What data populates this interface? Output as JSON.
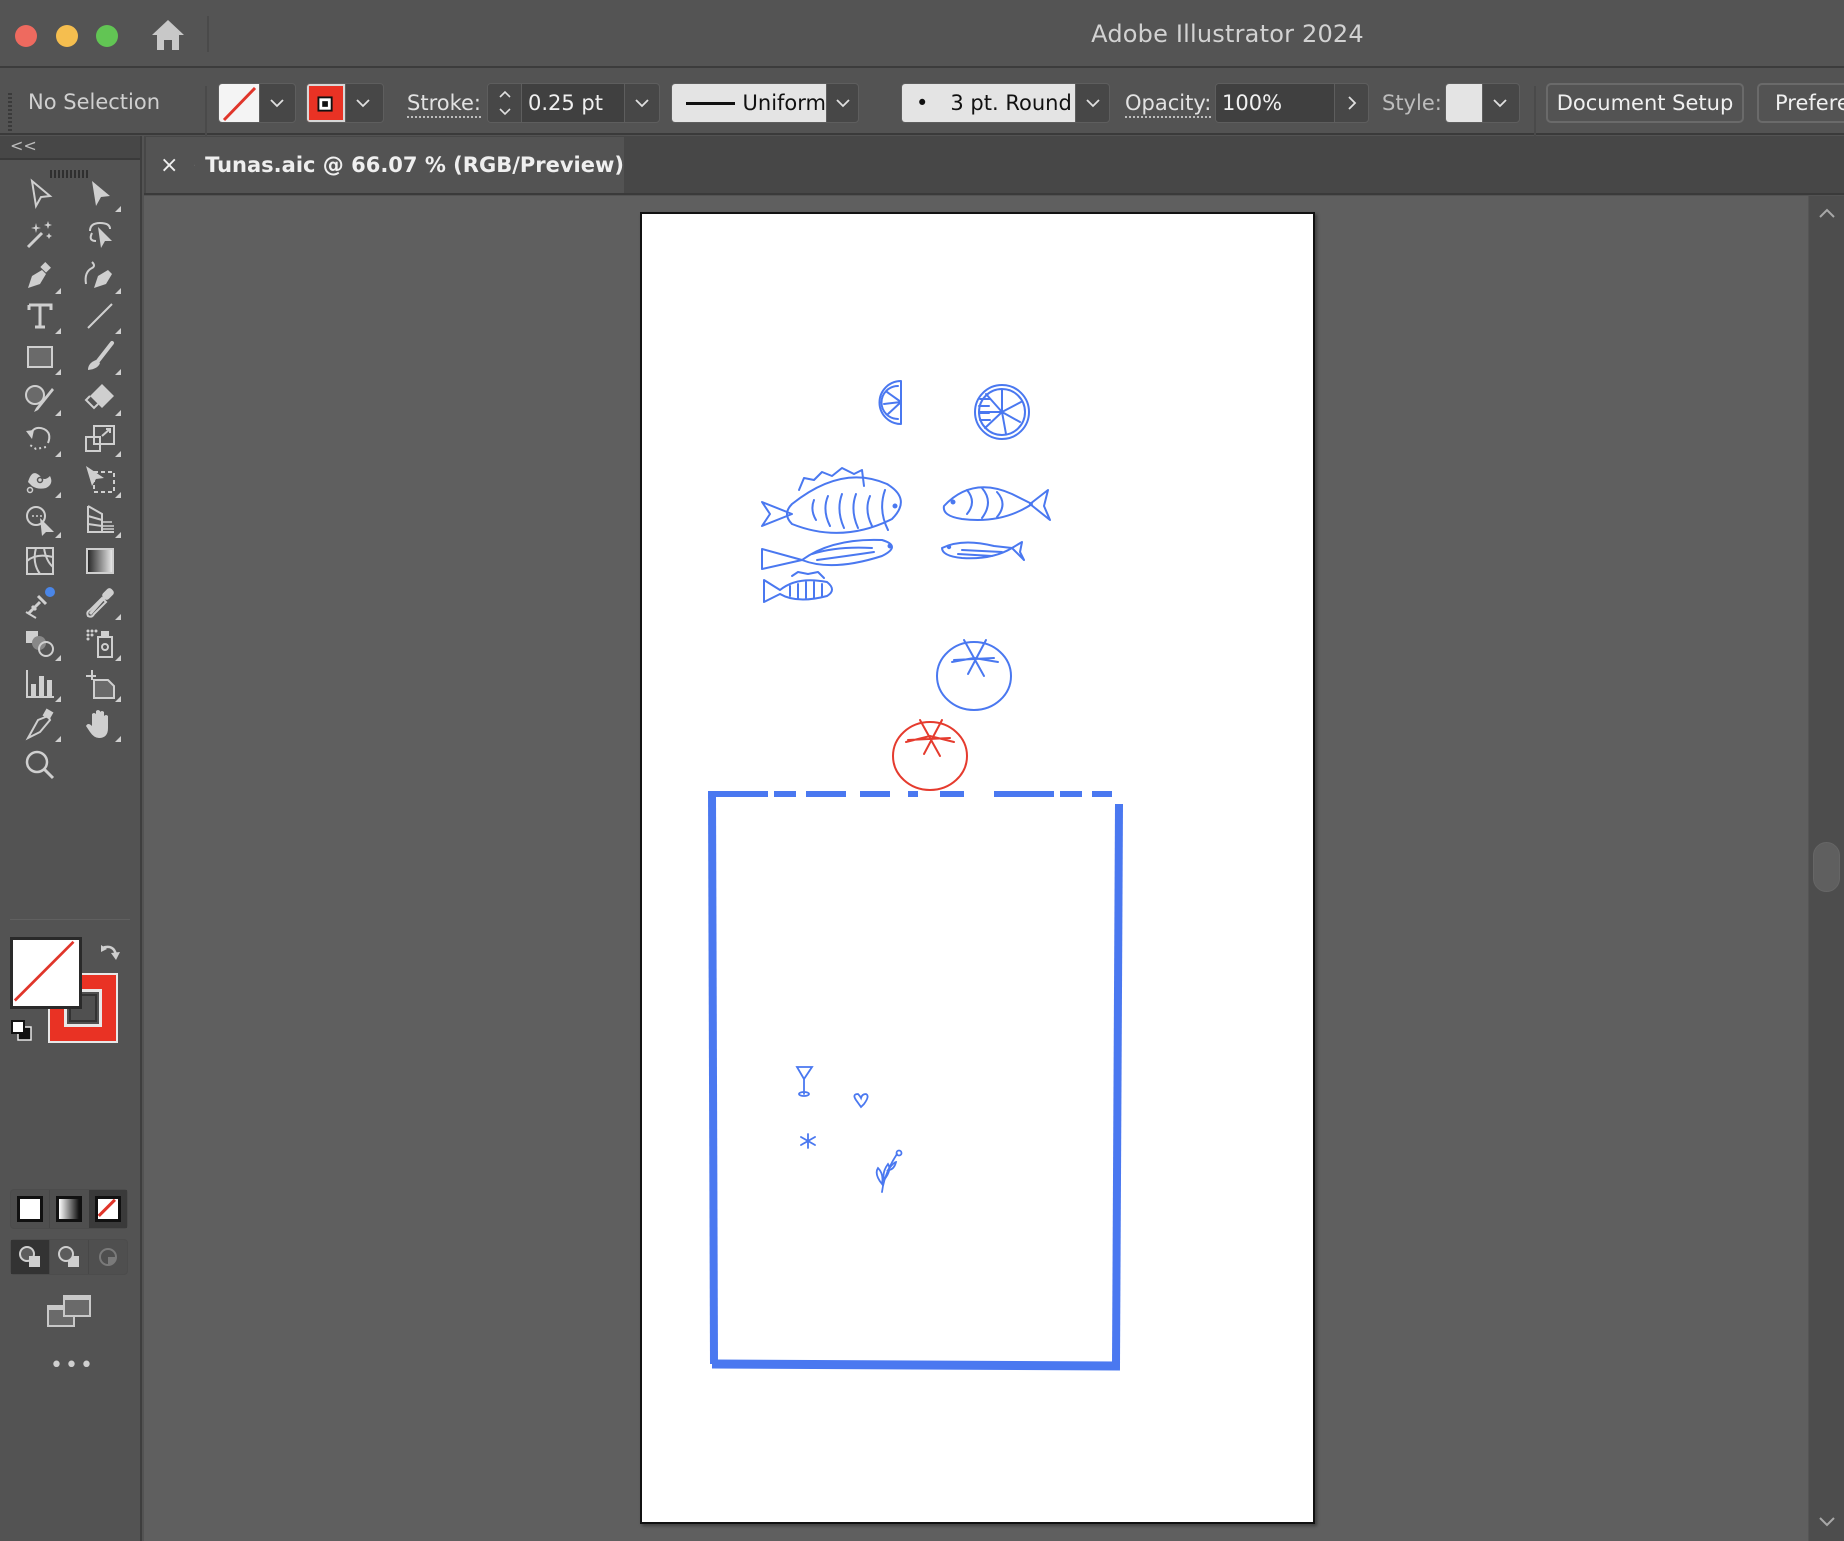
{
  "window": {
    "title": "Adobe Illustrator 2024",
    "traffic_lights": [
      "close",
      "minimize",
      "maximize"
    ]
  },
  "control_bar": {
    "selection_status": "No Selection",
    "fill": {
      "state": "none",
      "icon": "none-swatch-icon"
    },
    "stroke_swatch": {
      "color": "#e93224"
    },
    "stroke_label": "Stroke:",
    "stroke_weight": "0.25 pt",
    "variable_width_profile": "Uniform",
    "brush_definition": "3 pt. Round",
    "brush_dot": "•",
    "opacity_label": "Opacity:",
    "opacity_value": "100%",
    "style_label": "Style:",
    "document_setup_label": "Document Setup",
    "preferences_label": "Preferences"
  },
  "document_tab": {
    "close_glyph": "×",
    "title": "Tunas.aic @ 66.07 % (RGB/Preview)",
    "cloud_document": true
  },
  "sidebar": {
    "collapse_glyph": "<<",
    "tools": [
      [
        "selection-tool",
        "direct-selection-tool"
      ],
      [
        "magic-wand-tool",
        "lasso-tool"
      ],
      [
        "pen-tool",
        "curvature-tool"
      ],
      [
        "type-tool",
        "line-segment-tool"
      ],
      [
        "rectangle-tool",
        "paintbrush-tool"
      ],
      [
        "shaper-tool",
        "eraser-tool"
      ],
      [
        "rotate-tool",
        "scale-tool"
      ],
      [
        "puppet-warp-tool",
        "free-transform-tool"
      ],
      [
        "shape-builder-tool",
        "perspective-grid-tool"
      ],
      [
        "mesh-tool",
        "gradient-tool"
      ],
      [
        "eyedropper-retype-tool",
        "eyedropper-tool"
      ],
      [
        "blend-tool",
        "symbol-sprayer-tool"
      ],
      [
        "column-graph-tool",
        "artboard-tool"
      ],
      [
        "slice-tool",
        "hand-tool"
      ],
      [
        "zoom-tool"
      ]
    ],
    "fill_color_state": "none",
    "stroke_color": "#e93224",
    "color_modes": [
      "color",
      "gradient",
      "none"
    ],
    "draw_modes": [
      "draw-normal",
      "draw-behind",
      "draw-inside"
    ],
    "more_glyph": "•••"
  },
  "artwork": {
    "primary_color": "#4a78f0",
    "accent_color": "#e53b2e",
    "elements": [
      "lemon-half",
      "lemon-slice",
      "large-fish",
      "fish-right",
      "long-fish",
      "sardine",
      "small-fish",
      "blue-tomato",
      "red-tomato",
      "brush-frame",
      "cocktail-glass",
      "heart",
      "asterisk",
      "sprig"
    ]
  }
}
